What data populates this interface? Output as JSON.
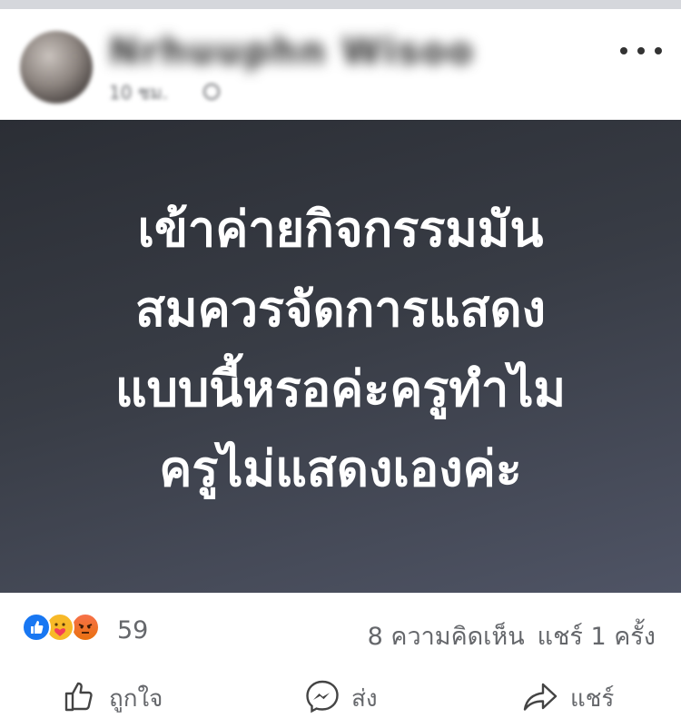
{
  "post": {
    "author_name": "Nrhuuphn Wisoo",
    "time": "10 ชม.",
    "image_text_lines": [
      "เข้าค่ายกิจกรรมมัน",
      "สมควรจัดการแสดง",
      "แบบนี้หรอค่ะครูทำไม",
      "ครูไม่แสดงเองค่ะ"
    ]
  },
  "reactions": {
    "types": [
      "like-icon",
      "care-icon",
      "angry-icon"
    ],
    "count": "59",
    "comments": "8 ความคิดเห็น",
    "shares": "แชร์ 1 ครั้ง"
  },
  "actions": {
    "like_label": "ถูกใจ",
    "send_label": "ส่ง",
    "share_label": "แชร์"
  },
  "colors": {
    "like_blue": "#1877f2",
    "meta_gray": "#65676b",
    "image_bg": "#363a43"
  }
}
